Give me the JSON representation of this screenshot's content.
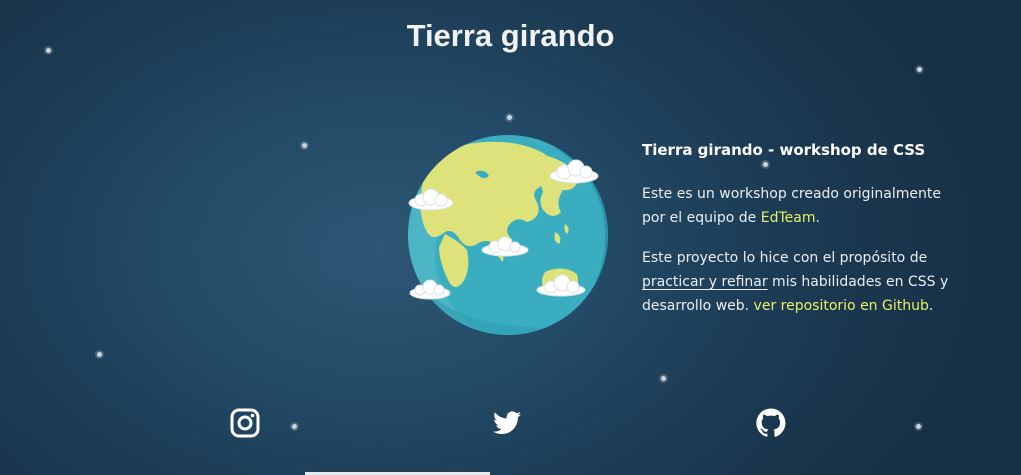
{
  "page": {
    "title": "Tierra girando"
  },
  "info": {
    "heading": "Tierra girando - workshop de CSS",
    "p1_text": "Este es un workshop creado originalmente por el equipo de ",
    "p1_link": "EdTeam",
    "p1_end": ".",
    "p2_text1": "Este proyecto lo hice con el propósito de ",
    "p2_underlined": "practicar y refinar",
    "p2_text2": " mis habilidades en CSS y desarrollo web. ",
    "p2_link": "ver repositorio en Github",
    "p2_end": "."
  },
  "social": [
    {
      "name": "instagram",
      "icon": "instagram-icon"
    },
    {
      "name": "twitter",
      "icon": "twitter-icon"
    },
    {
      "name": "github",
      "icon": "github-icon"
    }
  ],
  "colors": {
    "link_highlight": "#e6f06a",
    "ocean": "#3aaec0",
    "land": "#dde27a",
    "background": "#234a66"
  }
}
